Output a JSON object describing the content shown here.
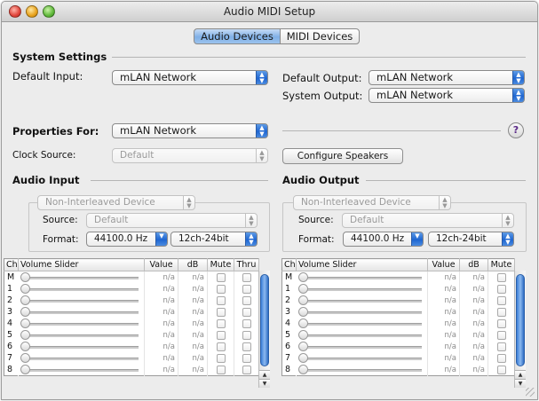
{
  "window": {
    "title": "Audio MIDI Setup"
  },
  "tabs": [
    {
      "label": "Audio Devices",
      "selected": true
    },
    {
      "label": "MIDI Devices",
      "selected": false
    }
  ],
  "system_settings": {
    "heading": "System Settings",
    "default_input_label": "Default Input:",
    "default_input_value": "mLAN Network",
    "default_output_label": "Default Output:",
    "default_output_value": "mLAN Network",
    "system_output_label": "System Output:",
    "system_output_value": "mLAN Network"
  },
  "properties": {
    "label": "Properties For:",
    "value": "mLAN Network",
    "help_label": "?"
  },
  "clock": {
    "label": "Clock Source:",
    "value": "Default",
    "configure_button": "Configure Speakers"
  },
  "audio_input": {
    "heading": "Audio Input",
    "device_mode": "Non-Interleaved Device",
    "source_label": "Source:",
    "source_value": "Default",
    "format_label": "Format:",
    "format_rate": "44100.0 Hz",
    "format_bits": "12ch-24bit",
    "columns": [
      "Ch",
      "Volume Slider",
      "Value",
      "dB",
      "Mute",
      "Thru"
    ],
    "rows": [
      {
        "ch": "M",
        "value": "n/a",
        "db": "n/a"
      },
      {
        "ch": "1",
        "value": "n/a",
        "db": "n/a"
      },
      {
        "ch": "2",
        "value": "n/a",
        "db": "n/a"
      },
      {
        "ch": "3",
        "value": "n/a",
        "db": "n/a"
      },
      {
        "ch": "4",
        "value": "n/a",
        "db": "n/a"
      },
      {
        "ch": "5",
        "value": "n/a",
        "db": "n/a"
      },
      {
        "ch": "6",
        "value": "n/a",
        "db": "n/a"
      },
      {
        "ch": "7",
        "value": "n/a",
        "db": "n/a"
      },
      {
        "ch": "8",
        "value": "n/a",
        "db": "n/a"
      }
    ]
  },
  "audio_output": {
    "heading": "Audio Output",
    "device_mode": "Non-Interleaved Device",
    "source_label": "Source:",
    "source_value": "Default",
    "format_label": "Format:",
    "format_rate": "44100.0 Hz",
    "format_bits": "12ch-24bit",
    "columns": [
      "Ch",
      "Volume Slider",
      "Value",
      "dB",
      "Mute"
    ],
    "rows": [
      {
        "ch": "M",
        "value": "n/a",
        "db": "n/a"
      },
      {
        "ch": "1",
        "value": "n/a",
        "db": "n/a"
      },
      {
        "ch": "2",
        "value": "n/a",
        "db": "n/a"
      },
      {
        "ch": "3",
        "value": "n/a",
        "db": "n/a"
      },
      {
        "ch": "4",
        "value": "n/a",
        "db": "n/a"
      },
      {
        "ch": "5",
        "value": "n/a",
        "db": "n/a"
      },
      {
        "ch": "6",
        "value": "n/a",
        "db": "n/a"
      },
      {
        "ch": "7",
        "value": "n/a",
        "db": "n/a"
      },
      {
        "ch": "8",
        "value": "n/a",
        "db": "n/a"
      }
    ]
  },
  "icons": {
    "popup_arrow": "updown-arrows-icon",
    "scroll_up": "scroll-up-arrow-icon",
    "scroll_down": "scroll-down-arrow-icon"
  },
  "colors": {
    "accent_blue": "#1f66d1",
    "window_bg": "#ececec"
  }
}
